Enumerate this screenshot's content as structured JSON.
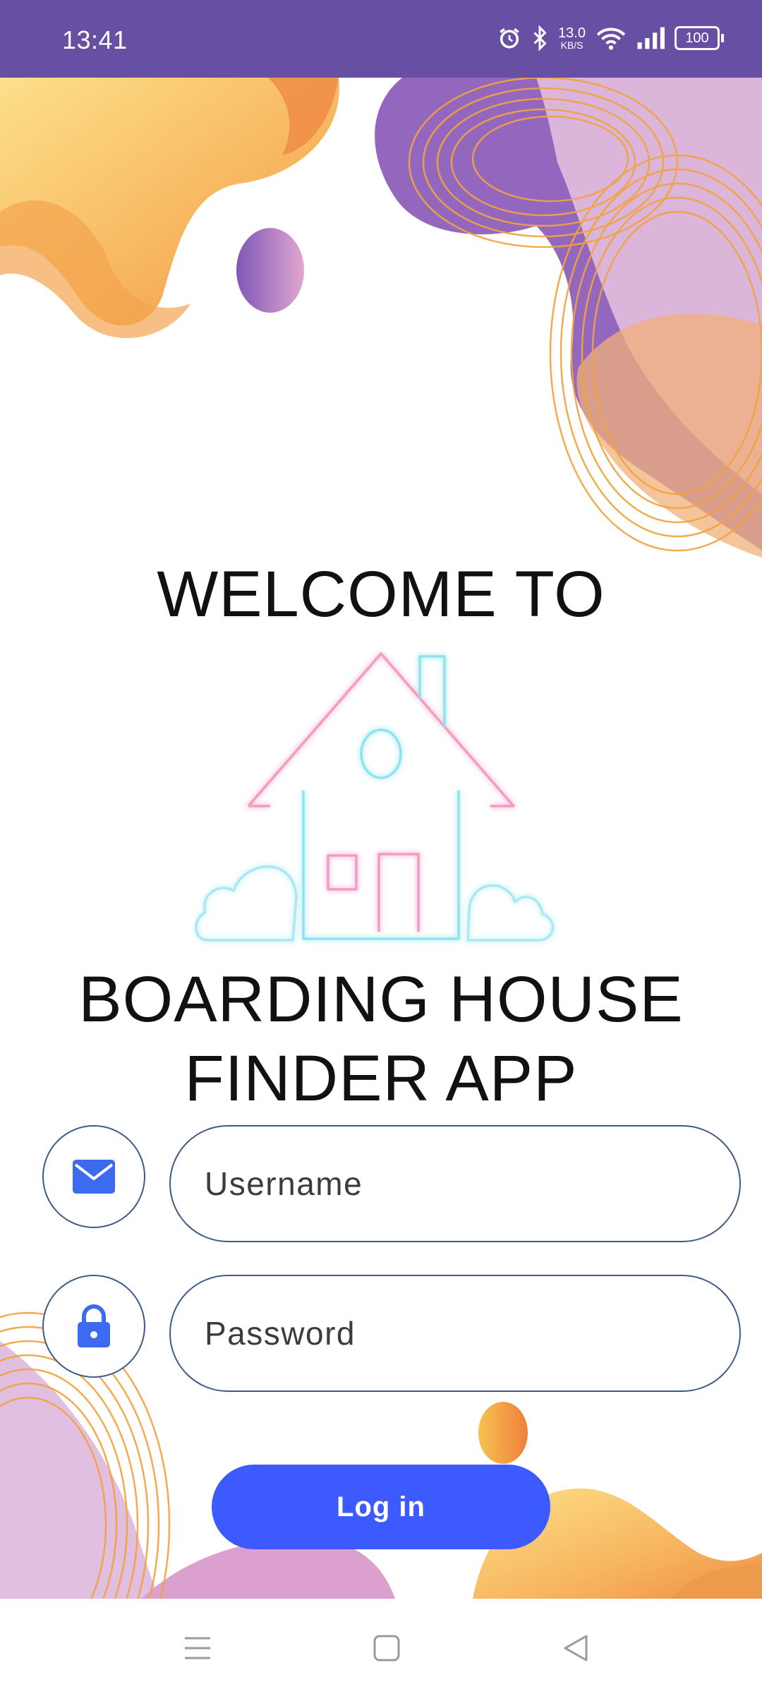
{
  "status_bar": {
    "time": "13:41",
    "net_speed_value": "13.0",
    "net_speed_unit": "KB/S",
    "battery": "100",
    "icons": [
      "alarm-icon",
      "bluetooth-icon",
      "wifi-icon",
      "signal-icon",
      "battery-icon"
    ]
  },
  "header": {
    "welcome": "WELCOME TO",
    "app_name_line1": "BOARDING HOUSE",
    "app_name_line2": "FINDER APP"
  },
  "form": {
    "username_placeholder": "Username",
    "password_placeholder": "Password",
    "login_label": "Log in"
  },
  "nav": {
    "icons": [
      "menu-icon",
      "home-square-icon",
      "back-triangle-icon"
    ]
  },
  "colors": {
    "status_bar": "#6750a4",
    "accent_button": "#3d5afe",
    "icon_blue": "#3d6bef",
    "field_border": "#3e5a86"
  }
}
